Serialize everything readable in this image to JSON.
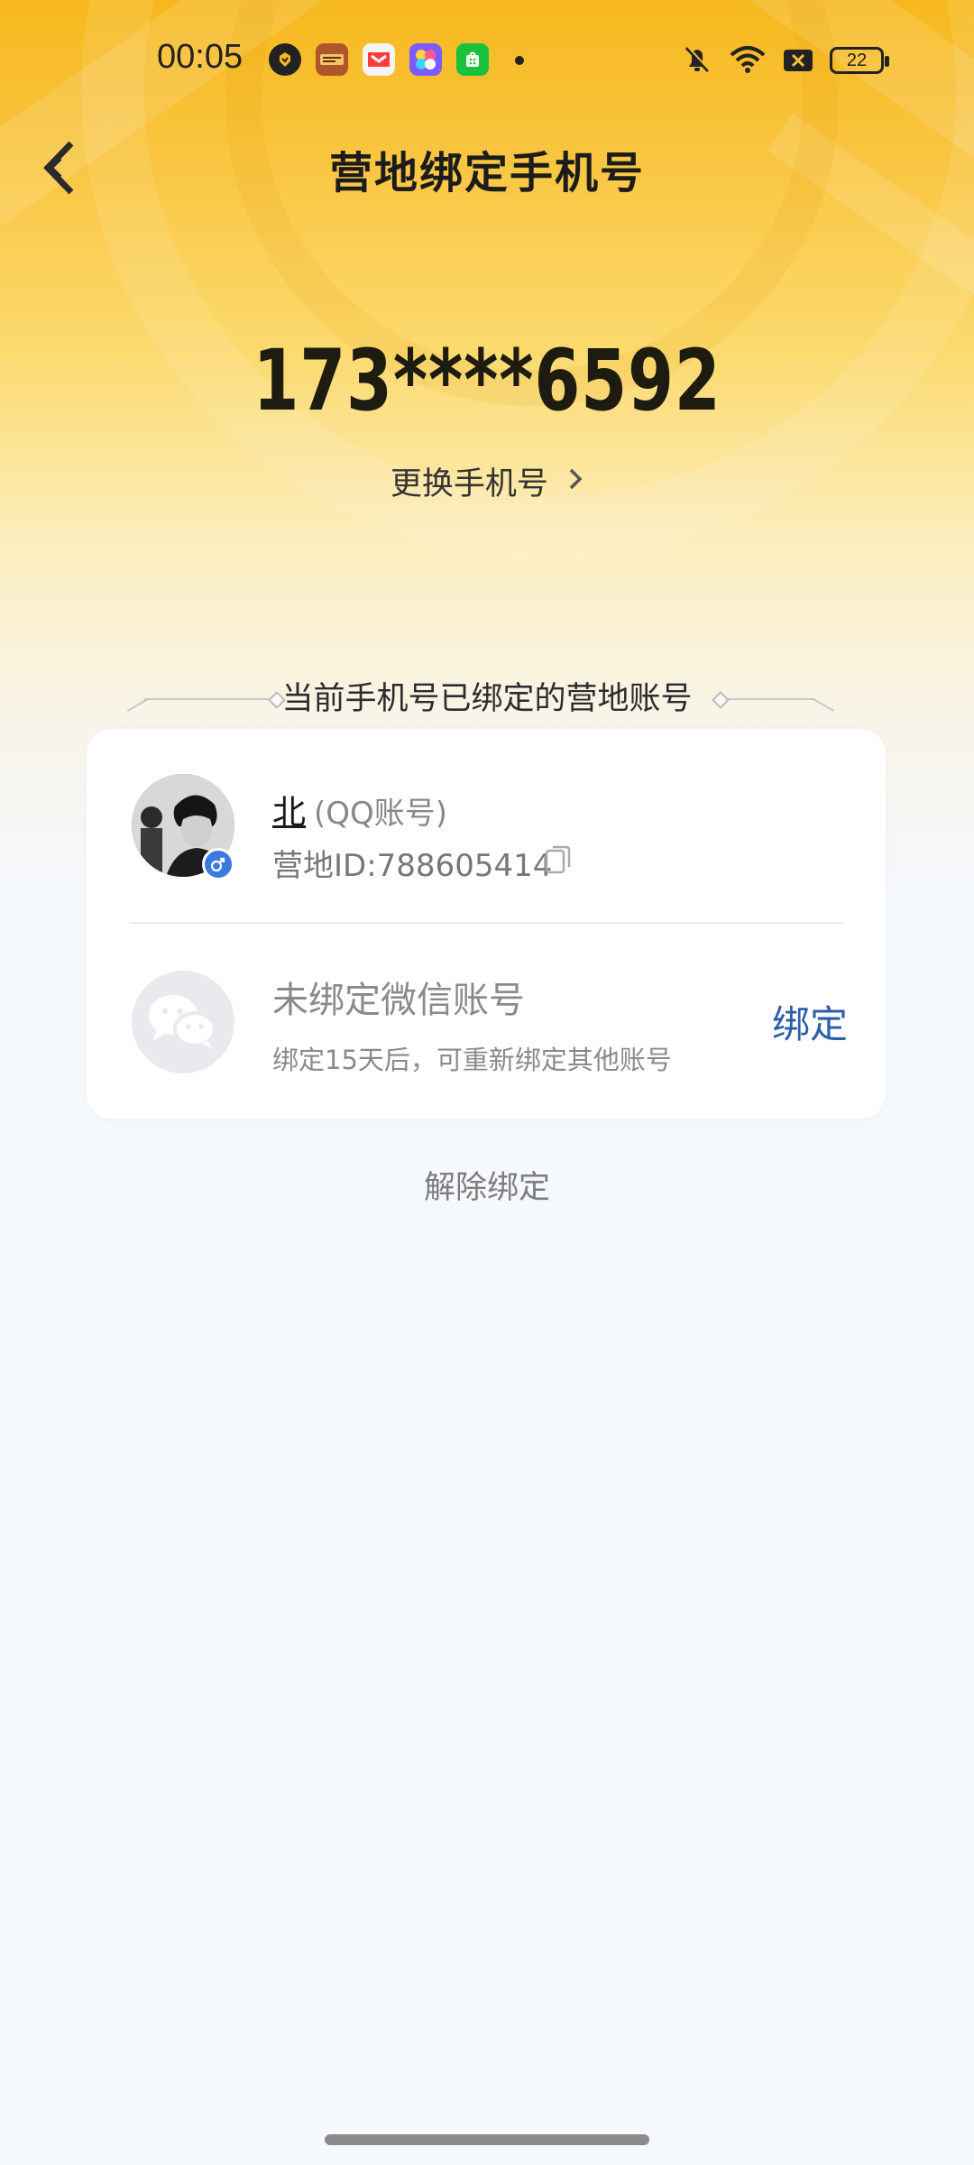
{
  "status_bar": {
    "time": "00:05",
    "battery_level": "22",
    "notification_icons": [
      "app-badge-icon",
      "game-app-icon",
      "video-app-icon",
      "photo-app-icon",
      "store-app-icon"
    ],
    "right_icons": [
      "mute-bell-icon",
      "wifi-icon",
      "sim-blocked-icon",
      "battery-icon"
    ]
  },
  "header": {
    "title": "营地绑定手机号",
    "back_icon": "chevron-left-icon"
  },
  "phone": {
    "masked_number": "173****6592",
    "change_link": "更换手机号"
  },
  "section": {
    "title": "当前手机号已绑定的营地账号"
  },
  "qq_account": {
    "nickname": "北",
    "type_label": "(QQ账号)",
    "camp_id": "营地ID:788605414",
    "gender_icon": "male-icon",
    "copy_icon": "copy-icon"
  },
  "wechat_account": {
    "title": "未绑定微信账号",
    "note": "绑定15天后，可重新绑定其他账号",
    "bind_label": "绑定",
    "icon": "wechat-icon"
  },
  "footer": {
    "unbind_label": "解除绑定"
  },
  "colors": {
    "hero_yellow": "#f6b81e",
    "page_bg": "#f5f8fd",
    "bind_blue": "#2c5fa8",
    "gender_blue": "#3b7ae0"
  }
}
